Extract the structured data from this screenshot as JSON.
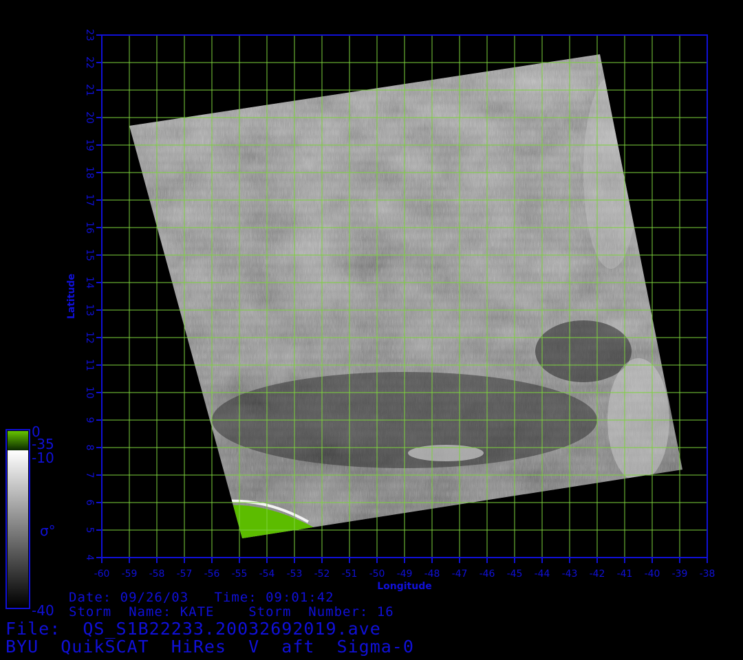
{
  "chart_data": {
    "type": "heatmap",
    "title": "BYU QuikSCAT HiRes V aft Sigma-0",
    "xlabel": "Longitude",
    "ylabel": "Latitude",
    "xlim": [
      -60,
      -38
    ],
    "ylim": [
      4,
      23
    ],
    "x_ticks": [
      -60,
      -59,
      -58,
      -57,
      -56,
      -55,
      -54,
      -53,
      -52,
      -51,
      -50,
      -49,
      -48,
      -47,
      -46,
      -45,
      -44,
      -43,
      -42,
      -41,
      -40,
      -39,
      -38
    ],
    "y_ticks": [
      4,
      5,
      6,
      7,
      8,
      9,
      10,
      11,
      12,
      13,
      14,
      15,
      16,
      17,
      18,
      19,
      20,
      21,
      22,
      23
    ],
    "grid": true,
    "swath_corners_lonlat": [
      [
        -59.0,
        19.7
      ],
      [
        -41.9,
        22.3
      ],
      [
        -38.9,
        7.2
      ],
      [
        -54.9,
        4.7
      ]
    ],
    "colorbar": {
      "label": "σ°",
      "gray_range": [
        -40,
        -10
      ],
      "green_range": [
        -35,
        0
      ],
      "ticks": [
        "0",
        "-35",
        "-10",
        "-40"
      ],
      "colors": {
        "low": "#000000",
        "high": "#ffffff",
        "green_low": "#0a2a00",
        "green_high": "#66c400"
      }
    }
  },
  "meta": {
    "date_line": "Date: 09/26/03   Time: 09:01:42",
    "storm_line": "Storm  Name: KATE    Storm  Number: 16",
    "file_line": "File:  QS_S1B22233.20032692019.ave",
    "title_line": "BYU  QuikSCAT  HiRes  V  aft  Sigma-0"
  },
  "colors": {
    "axis": "#1010d8",
    "grid": "#7cd23c",
    "background": "#000000"
  }
}
